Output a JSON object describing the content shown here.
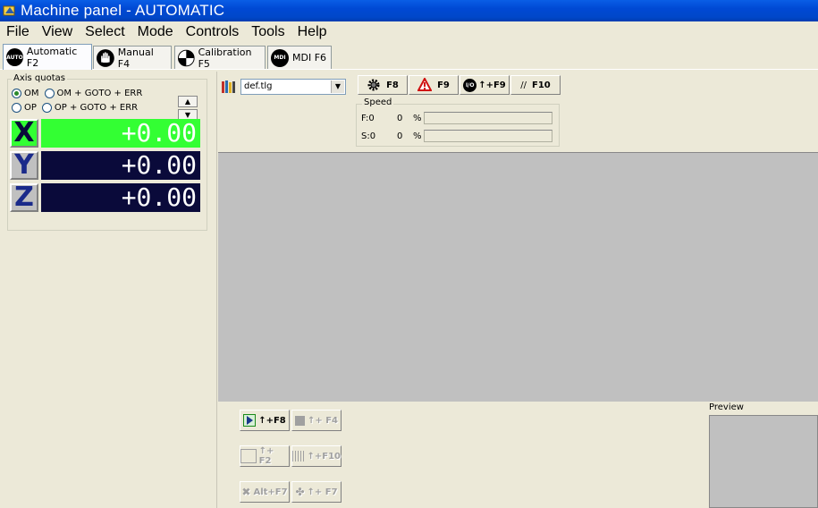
{
  "window": {
    "title": "Machine panel - AUTOMATIC"
  },
  "menu": [
    "File",
    "View",
    "Select",
    "Mode",
    "Controls",
    "Tools",
    "Help"
  ],
  "tabs": [
    {
      "icon": "AUTO",
      "label": "Automatic F2",
      "active": true
    },
    {
      "icon": "hand-icon",
      "label": "Manual F4"
    },
    {
      "icon": "target-icon",
      "label": "Calibration F5"
    },
    {
      "icon": "MDI",
      "label": "MDI F6"
    }
  ],
  "axis_quotas": {
    "label": "Axis quotas",
    "options": [
      "OM",
      "OM + GOTO + ERR",
      "OP",
      "OP + GOTO + ERR"
    ],
    "selected": "OM",
    "axes": [
      {
        "name": "X",
        "value": "+0.00",
        "color": "#33ff33"
      },
      {
        "name": "Y",
        "value": "+0.00",
        "color": "#0a0a3a"
      },
      {
        "name": "Z",
        "value": "+0.00",
        "color": "#0a0a3a"
      }
    ]
  },
  "toolbar": {
    "file_combo": "def.tlg",
    "buttons": [
      {
        "icon": "gear-icon",
        "label": "F8"
      },
      {
        "icon": "warning-icon",
        "label": "F9"
      },
      {
        "icon": "io-icon",
        "label": "↑+F9",
        "icon_text": "I/O"
      },
      {
        "icon": "slashes-icon",
        "label": "F10",
        "icon_text": "//"
      }
    ]
  },
  "speed": {
    "label": "Speed",
    "rows": [
      {
        "label": "F:0",
        "value": "0",
        "unit": "%"
      },
      {
        "label": "S:0",
        "value": "0",
        "unit": "%"
      }
    ]
  },
  "bottom_buttons": [
    {
      "label": "↑+F8",
      "enabled": true
    },
    {
      "label": "↑+ F4",
      "enabled": false
    },
    {
      "label": "↑+ F2",
      "enabled": false
    },
    {
      "label": "↑+F10",
      "enabled": false
    },
    {
      "label": "Alt+F7",
      "enabled": false
    },
    {
      "label": "↑+ F7",
      "enabled": false
    }
  ],
  "preview": {
    "label": "Preview"
  },
  "colors": {
    "title_bar": "#0049d4",
    "panel": "#ece9d8",
    "canvas": "#c0c0c0",
    "axis_active": "#33ff33",
    "axis_idle": "#0a0a3a"
  }
}
